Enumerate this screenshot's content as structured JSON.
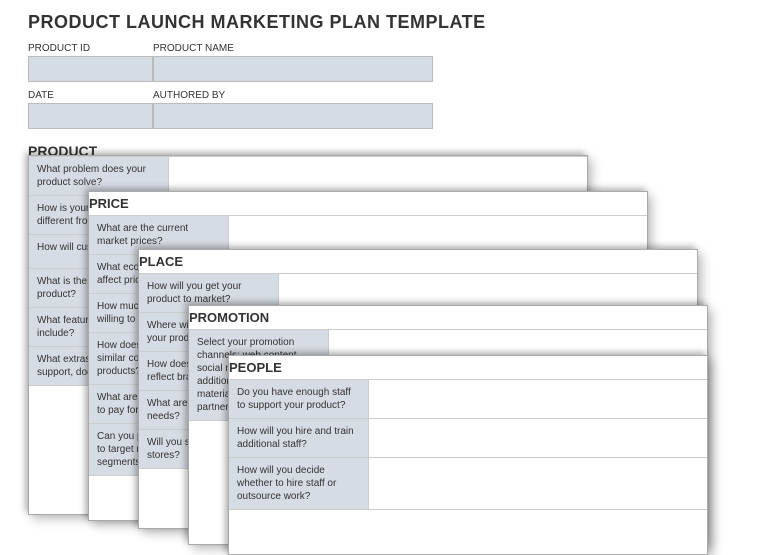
{
  "title": "PRODUCT LAUNCH MARKETING PLAN TEMPLATE",
  "meta": {
    "row1": {
      "label1": "PRODUCT ID",
      "label2": "PRODUCT NAME"
    },
    "row2": {
      "label1": "DATE",
      "label2": "AUTHORED BY"
    }
  },
  "cards": {
    "product": {
      "header": "PRODUCT",
      "rows": [
        "What problem does your product solve?",
        "How is your product different from competitors?",
        "How will customers use it?",
        "What is the value of your product?",
        "What features does it include?",
        "What extras, such as support, does it come with?"
      ]
    },
    "price": {
      "header": "PRICE",
      "rows": [
        "What are the current market prices?",
        "What economic factors affect pricing?",
        "How much are customers willing to pay?",
        "How does price compare to similar competitor products?",
        "What are customers willing to pay for your product?",
        "Can you price one product to target multiple segments?"
      ]
    },
    "place": {
      "header": "PLACE",
      "rows": [
        "How will you get your product to market?",
        "Where will customers find your product?",
        "How does placement reflect brand positioning?",
        "What are your delivery needs?",
        "Will you sell online or in stores?"
      ]
    },
    "promotion": {
      "header": "PROMOTION",
      "rows": [
        "Select your promotion channels: web content, social media, email, additional marketing materials, other channels, partnerships"
      ]
    },
    "people": {
      "header": "PEOPLE",
      "rows": [
        "Do you have enough staff to support your product?",
        "How will you hire and train additional staff?",
        "How will you decide whether to hire staff or outsource work?"
      ]
    }
  }
}
